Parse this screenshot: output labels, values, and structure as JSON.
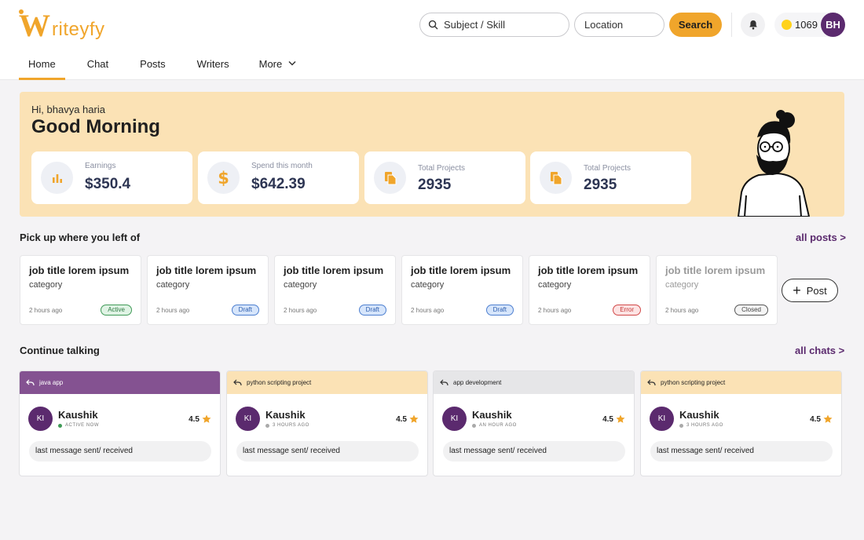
{
  "brand": {
    "logo_w": "W",
    "logo_rest": "riteyfy",
    "accent": "#f0a52b",
    "purple": "#5b2a6e"
  },
  "header": {
    "search_placeholder": "Subject / Skill",
    "location_placeholder": "Location",
    "search_label": "Search",
    "coins": "1069",
    "avatar_initials": "BH",
    "icons": [
      "search-icon",
      "bell-icon",
      "coin-icon"
    ]
  },
  "nav": {
    "items": [
      "Home",
      "Chat",
      "Posts",
      "Writers",
      "More"
    ],
    "active": "Home"
  },
  "hero": {
    "greeting": "Hi, bhavya haria",
    "title": "Good Morning",
    "stats": [
      {
        "label": "Earnings",
        "value": "$350.4",
        "icon": "bar-chart-icon"
      },
      {
        "label": "Spend this month",
        "value": "$642.39",
        "icon": "dollar-icon"
      },
      {
        "label": "Total Projects",
        "value": "2935",
        "icon": "documents-icon"
      },
      {
        "label": "Total Projects",
        "value": "2935",
        "icon": "documents-icon"
      }
    ]
  },
  "pickup": {
    "title": "Pick up where you left of",
    "link": "all posts >",
    "post_button": "Post",
    "jobs": [
      {
        "title": "job title lorem ipsum",
        "category": "category",
        "time": "2 hours ago",
        "status": "Active"
      },
      {
        "title": "job title lorem ipsum",
        "category": "category",
        "time": "2 hours ago",
        "status": "Draft"
      },
      {
        "title": "job title lorem ipsum",
        "category": "category",
        "time": "2 hours ago",
        "status": "Draft"
      },
      {
        "title": "job title lorem ipsum",
        "category": "category",
        "time": "2 hours ago",
        "status": "Draft"
      },
      {
        "title": "job title lorem ipsum",
        "category": "category",
        "time": "2 hours ago",
        "status": "Error"
      },
      {
        "title": "job title lorem ipsum",
        "category": "category",
        "time": "2 hours ago",
        "status": "Closed"
      }
    ]
  },
  "chats": {
    "title": "Continue talking",
    "link": "all chats >",
    "items": [
      {
        "project": "java app",
        "name": "Kaushik",
        "initials": "KI",
        "status": "ACTIVE NOW",
        "rating": "4.5",
        "message": "last message sent/ received"
      },
      {
        "project": "python scripting project",
        "name": "Kaushik",
        "initials": "KI",
        "status": "3 HOURS AGO",
        "rating": "4.5",
        "message": "last message sent/ received"
      },
      {
        "project": "app development",
        "name": "Kaushik",
        "initials": "KI",
        "status": "AN HOUR AGO",
        "rating": "4.5",
        "message": "last message sent/ received"
      },
      {
        "project": "python scripting project",
        "name": "Kaushik",
        "initials": "KI",
        "status": "3 HOURS AGO",
        "rating": "4.5",
        "message": "last message sent/ received"
      }
    ]
  }
}
